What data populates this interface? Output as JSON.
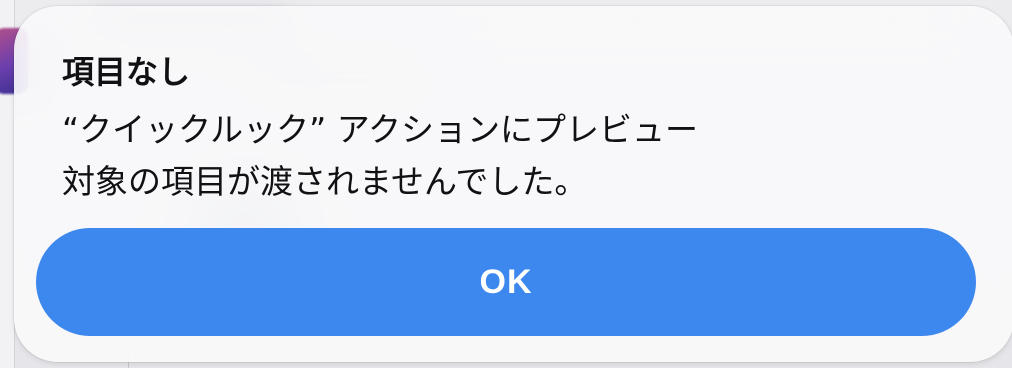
{
  "alert": {
    "title": "項目なし",
    "message_line_1": "“クイックルック” アクションにプレビュー",
    "message_line_2": "対象の項目が渡されませんでした。",
    "ok_label": "OK"
  },
  "colors": {
    "button": "#3d88ee",
    "button_text": "#ffffff",
    "card": "#fafafb",
    "text": "#111114"
  }
}
